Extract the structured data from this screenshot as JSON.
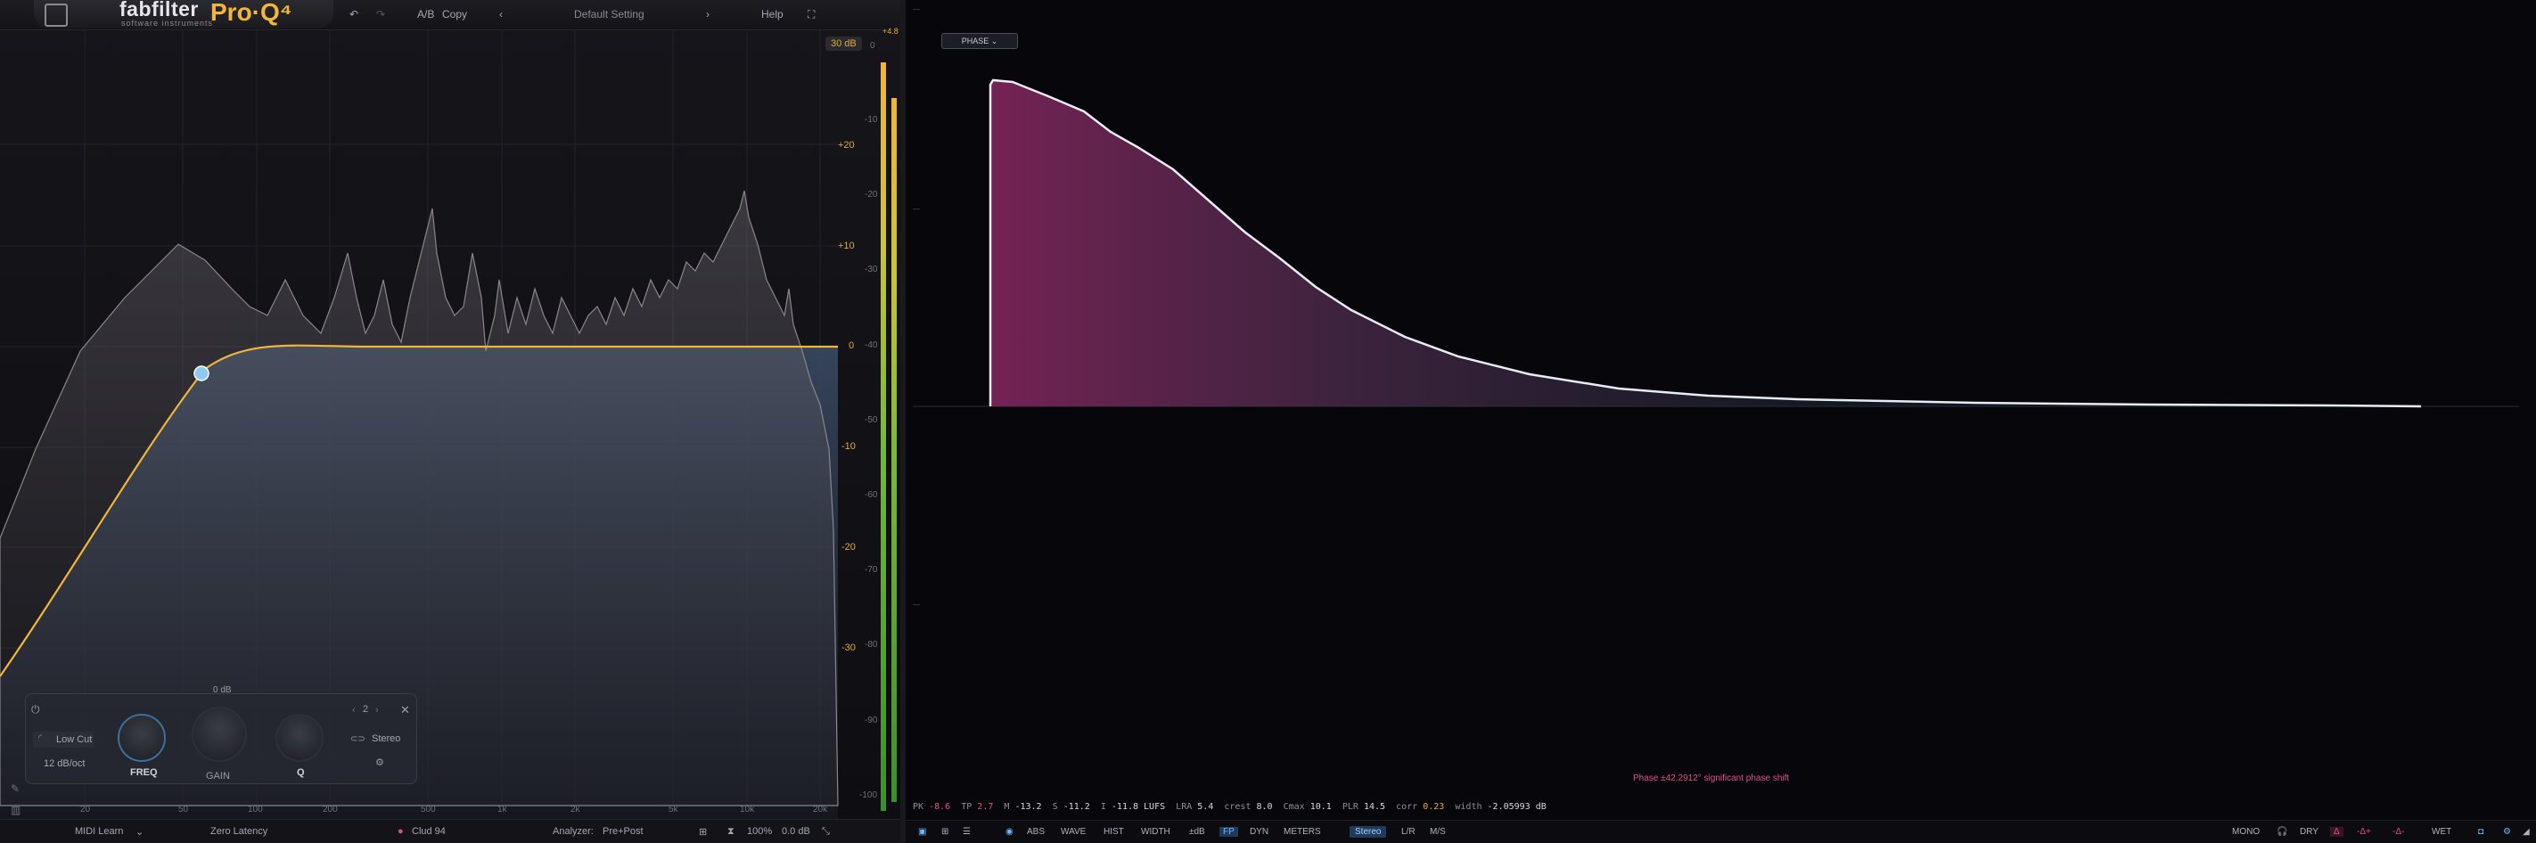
{
  "topbar": {
    "brand": "fabfilter",
    "brand_sub": "software instruments",
    "product": "Pro·Q⁴",
    "ab": "A/B",
    "copy": "Copy",
    "preset": "Default Setting",
    "help": "Help"
  },
  "eq": {
    "range_badge": "30 dB",
    "db_scale": [
      "+20",
      "+10",
      "0",
      "-10",
      "-20",
      "-30"
    ],
    "level_scale": [
      "0",
      "-10",
      "-20",
      "-30",
      "-40",
      "-50",
      "-60",
      "-70",
      "-80",
      "-90",
      "-100"
    ],
    "freq_labels": [
      "20",
      "50",
      "100",
      "200",
      "500",
      "1k",
      "2k",
      "5k",
      "10k",
      "20k"
    ],
    "meter_top_label": "+4.8"
  },
  "band_panel": {
    "gain_top": "0 dB",
    "band_number": "2",
    "filter_type": "Low Cut",
    "slope": "12 dB/oct",
    "freq_label": "FREQ",
    "gain_label": "GAIN",
    "q_label": "Q",
    "stereo": "Stereo"
  },
  "bottombar": {
    "midi": "MIDI Learn",
    "latency": "Zero Latency",
    "track": "Clud 94",
    "analyzer_label": "Analyzer:",
    "analyzer_value": "Pre+Post",
    "zoom": "100%",
    "output": "0.0 dB"
  },
  "phase_view": {
    "mode_button": "PHASE ⌄",
    "message": "Phase ±42.2912° significant phase shift",
    "colors": {
      "fill_top": "#6a2450",
      "fill_bottom": "#1a2a3a",
      "curve": "#dfe6f0"
    }
  },
  "stats": {
    "pk_l": "PK",
    "pk": "-8.6",
    "tp_l": "TP",
    "tp": "2.7",
    "m_l": "M",
    "m": "-13.2",
    "s_l": "S",
    "s": "-11.2",
    "i_l": "I",
    "i": "-11.8 LUFS",
    "lra_l": "LRA",
    "lra": "5.4",
    "crest_l": "crest",
    "crest": "8.0",
    "cmax_l": "Cmax",
    "cmax": "10.1",
    "plr_l": "PLR",
    "plr": "14.5",
    "corr_l": "corr",
    "corr": "0.23",
    "width_l": "width",
    "width": "-2.05993 dB"
  },
  "rbar": {
    "abs": "ABS",
    "wave": "WAVE",
    "hist": "HIST",
    "width": "WIDTH",
    "db": "±dB",
    "fp": "FP",
    "dyn": "DYN",
    "meters": "METERS",
    "stereo": "Stereo",
    "lr": "L/R",
    "ms": "M/S",
    "mono": "MONO",
    "dry": "DRY",
    "delta1": "-Δ+",
    "delta2": "-Δ-",
    "wet": "WET"
  }
}
